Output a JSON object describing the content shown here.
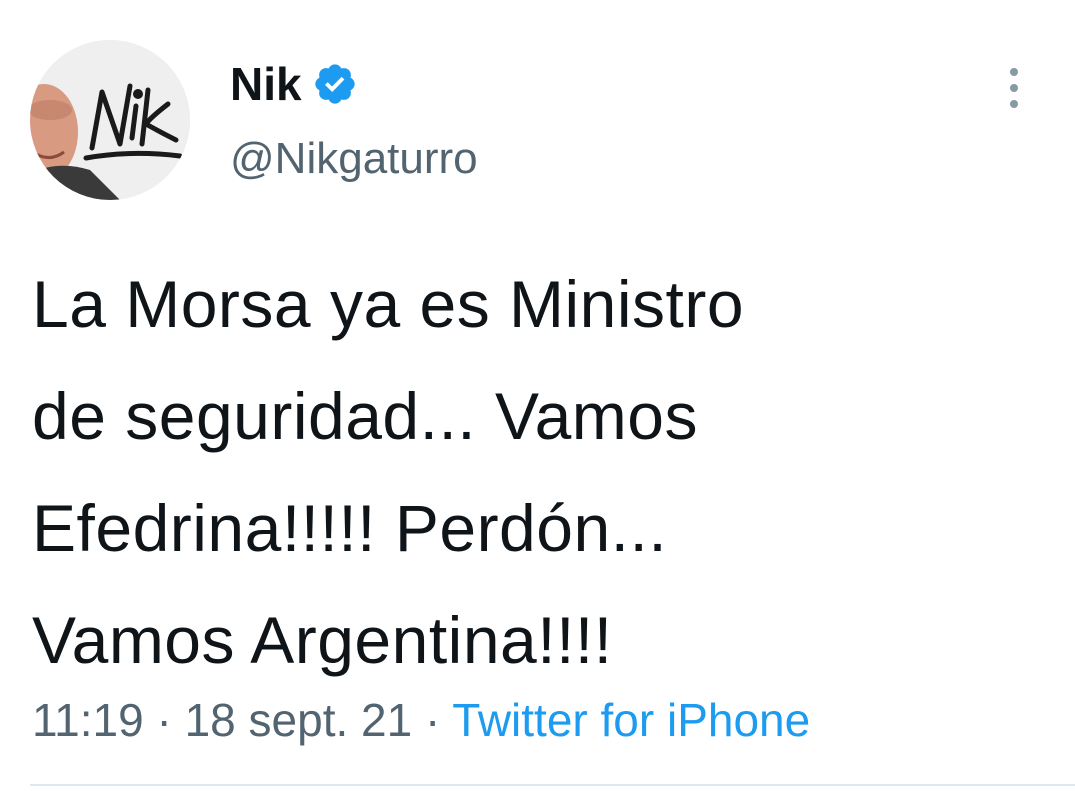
{
  "author": {
    "display_name": "Nik",
    "handle": "@Nikgaturro",
    "verified": true,
    "avatar_signature": "Nik"
  },
  "tweet": {
    "lines": [
      "La Morsa ya es Ministro",
      "de seguridad... Vamos",
      "Efedrina!!!!! Perdón...",
      "Vamos Argentina!!!!"
    ],
    "time": "11:19",
    "separator": " · ",
    "date": "18 sept. 21",
    "source": "Twitter for iPhone"
  },
  "colors": {
    "text": "#0f1419",
    "secondary": "#536471",
    "accent": "#1d9bf0"
  },
  "icons": {
    "verified": "verified-badge-icon",
    "more": "more-options-icon"
  }
}
